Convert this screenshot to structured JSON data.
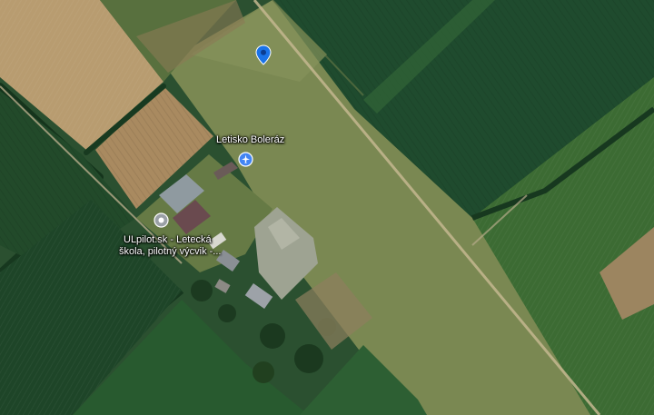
{
  "places": [
    {
      "label": "Letisko Boleráz",
      "icon": "airport-icon",
      "color": "#4285f4"
    },
    {
      "label_lines": [
        "ULpilot.sk - Letecká",
        "škola, pilotný výcvik -..."
      ],
      "icon": "school-icon",
      "color": "#9aa0a6"
    }
  ],
  "marker": {
    "icon": "location-pin-icon",
    "color": "#1a73e8"
  },
  "colors": {
    "field_dark": "#1f4a2c",
    "field_green": "#2f5d31",
    "field_wheat": "#b59a6e",
    "field_stubble": "#a88a5f",
    "runway_grass": "#7c8a55",
    "road": "#b8ad8e"
  }
}
